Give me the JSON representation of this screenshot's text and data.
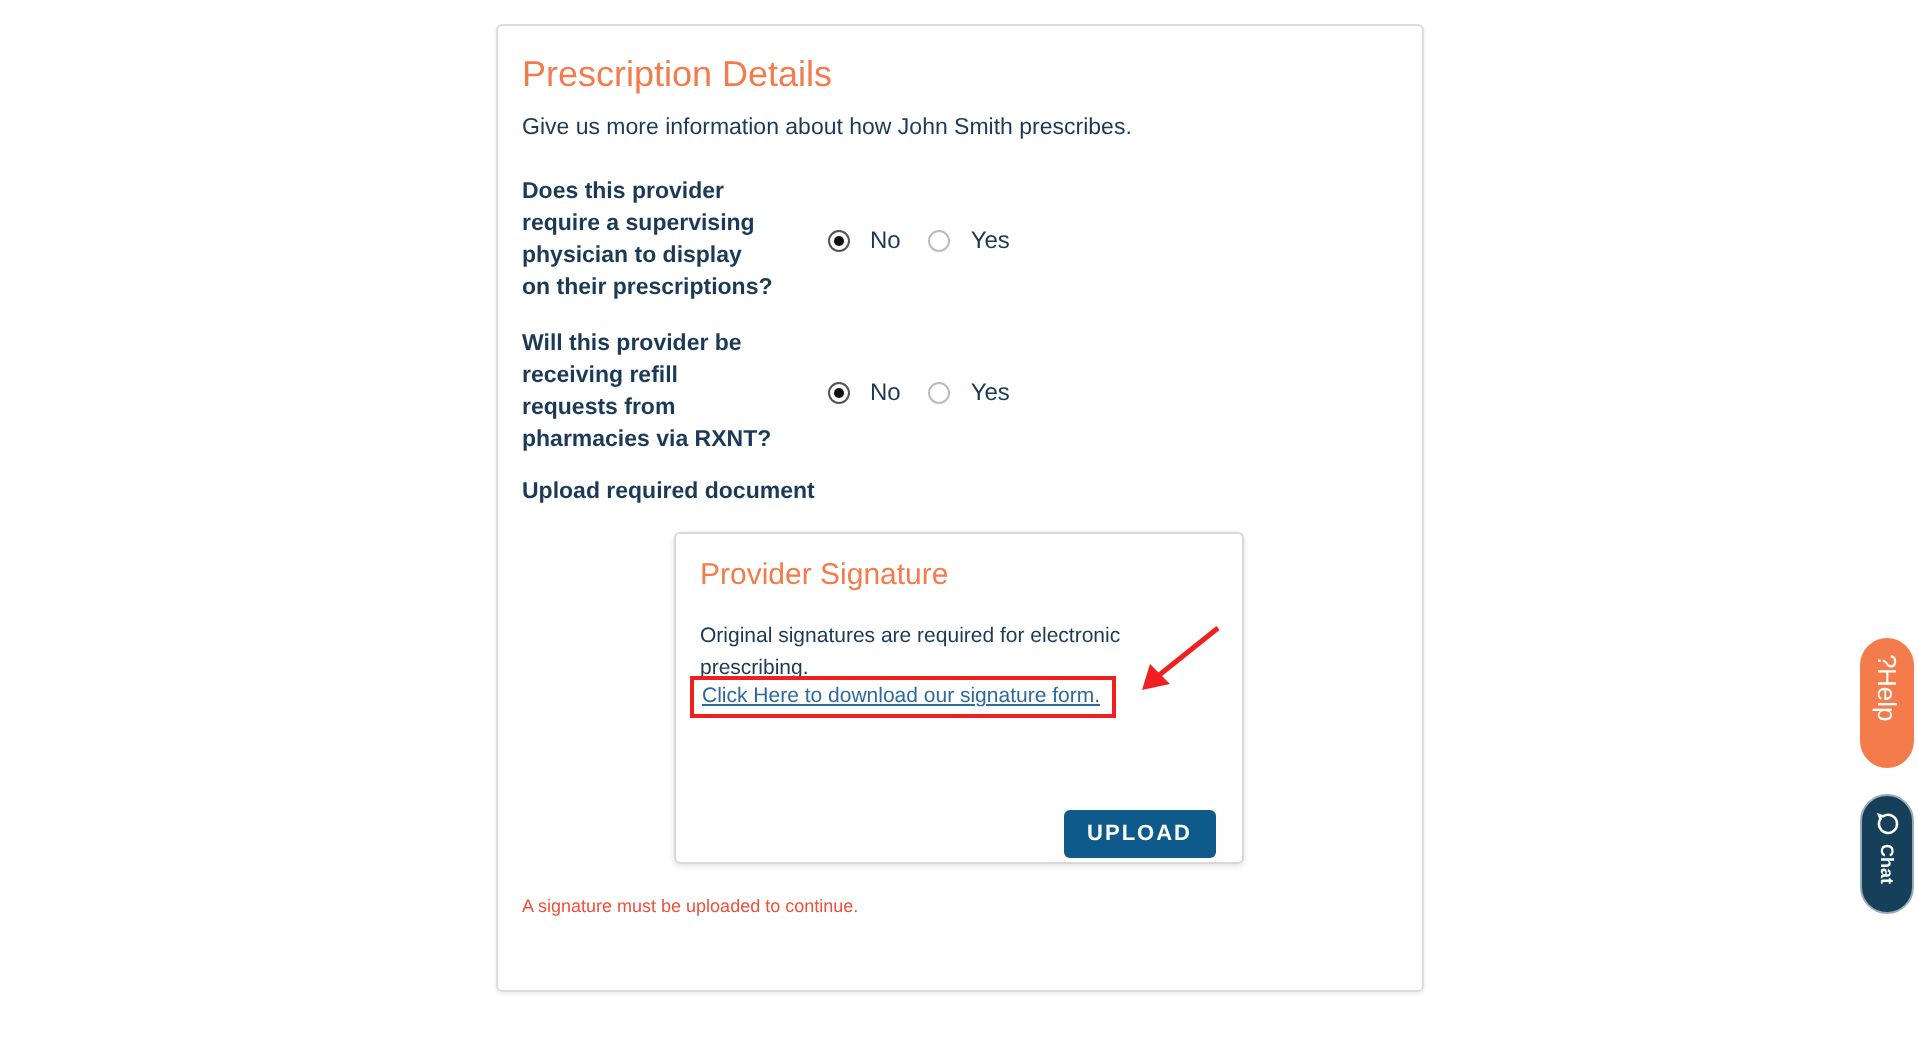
{
  "title": "Prescription Details",
  "intro": "Give us more information about how John Smith prescribes.",
  "questions": [
    {
      "label": "Does this provider require a supervising physician to display on their prescriptions?",
      "options": [
        {
          "label": "No",
          "selected": true
        },
        {
          "label": "Yes",
          "selected": false
        }
      ]
    },
    {
      "label": "Will this provider be receiving refill requests from pharmacies via RXNT?",
      "options": [
        {
          "label": "No",
          "selected": true
        },
        {
          "label": "Yes",
          "selected": false
        }
      ]
    }
  ],
  "upload_label": "Upload required document",
  "upload_card": {
    "title": "Provider Signature",
    "text": "Original signatures are required for electronic prescribing.",
    "link": "Click Here to download our signature form.",
    "button": "UPLOAD"
  },
  "error": "A signature must be uploaded to continue.",
  "side_buttons": [
    {
      "kind": "help",
      "icon": "?",
      "label": "Help"
    },
    {
      "kind": "chat",
      "label": "Chat"
    }
  ]
}
